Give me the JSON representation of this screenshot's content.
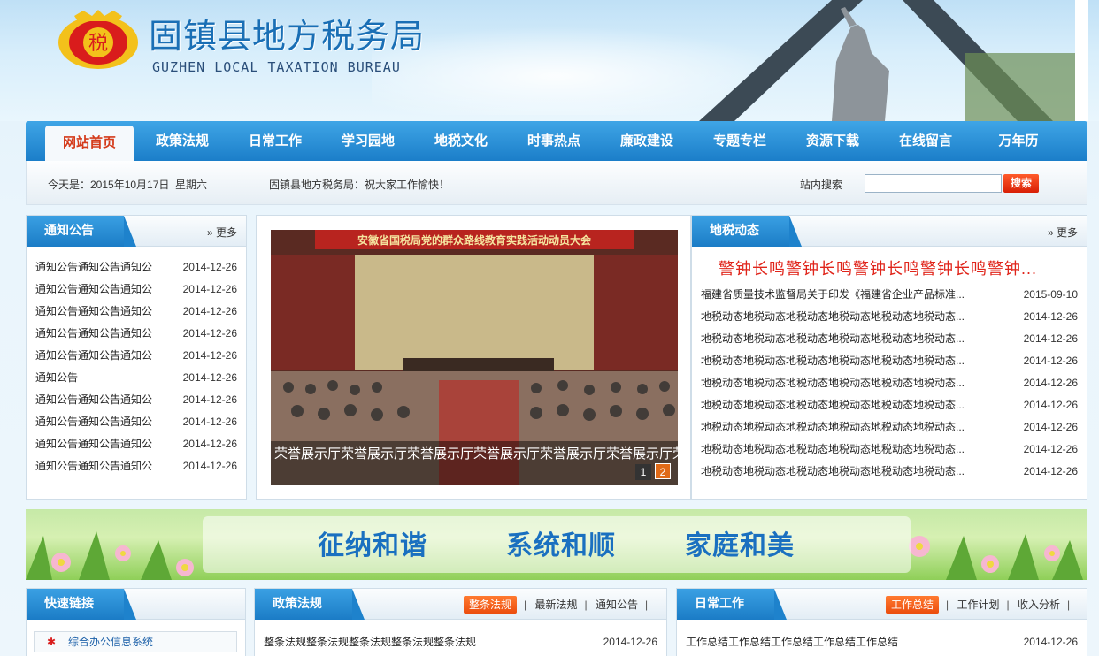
{
  "header": {
    "title": "固镇县地方税务局",
    "subtitle": "GUZHEN LOCAL TAXATION BUREAU",
    "emblem_glyph": "税"
  },
  "nav": {
    "items": [
      "网站首页",
      "政策法规",
      "日常工作",
      "学习园地",
      "地税文化",
      "时事热点",
      "廉政建设",
      "专题专栏",
      "资源下载",
      "在线留言",
      "万年历"
    ]
  },
  "infobar": {
    "date": "今天是：2015年10月17日",
    "weekday": "星期六",
    "greeting": "固镇县地方税务局：祝大家工作愉快！",
    "search_label": "站内搜索",
    "search_value": "",
    "search_button": "搜索"
  },
  "notice": {
    "title": "通知公告",
    "more": "更多",
    "items": [
      {
        "title": "通知公告通知公告通知公",
        "date": "2014-12-26"
      },
      {
        "title": "通知公告通知公告通知公",
        "date": "2014-12-26"
      },
      {
        "title": "通知公告通知公告通知公",
        "date": "2014-12-26"
      },
      {
        "title": "通知公告通知公告通知公",
        "date": "2014-12-26"
      },
      {
        "title": "通知公告通知公告通知公",
        "date": "2014-12-26"
      },
      {
        "title": "通知公告",
        "date": "2014-12-26"
      },
      {
        "title": "通知公告通知公告通知公",
        "date": "2014-12-26"
      },
      {
        "title": "通知公告通知公告通知公",
        "date": "2014-12-26"
      },
      {
        "title": "通知公告通知公告通知公",
        "date": "2014-12-26"
      },
      {
        "title": "通知公告通知公告通知公",
        "date": "2014-12-26"
      }
    ]
  },
  "slider": {
    "banner_text": "安徽省国税局党的群众路线教育实践活动动员大会",
    "caption": "荣誉展示厅荣誉展示厅荣誉展示厅荣誉展示厅荣誉展示厅荣誉展示厅荣誉展示厅荣",
    "pages": [
      "1",
      "2"
    ]
  },
  "news": {
    "title": "地税动态",
    "more": "更多",
    "headline": "警钟长鸣警钟长鸣警钟长鸣警钟长鸣警钟...",
    "items": [
      {
        "title": "福建省质量技术监督局关于印发《福建省企业产品标准...",
        "date": "2015-09-10"
      },
      {
        "title": "地税动态地税动态地税动态地税动态地税动态地税动态...",
        "date": "2014-12-26"
      },
      {
        "title": "地税动态地税动态地税动态地税动态地税动态地税动态...",
        "date": "2014-12-26"
      },
      {
        "title": "地税动态地税动态地税动态地税动态地税动态地税动态...",
        "date": "2014-12-26"
      },
      {
        "title": "地税动态地税动态地税动态地税动态地税动态地税动态...",
        "date": "2014-12-26"
      },
      {
        "title": "地税动态地税动态地税动态地税动态地税动态地税动态...",
        "date": "2014-12-26"
      },
      {
        "title": "地税动态地税动态地税动态地税动态地税动态地税动态...",
        "date": "2014-12-26"
      },
      {
        "title": "地税动态地税动态地税动态地税动态地税动态地税动态...",
        "date": "2014-12-26"
      },
      {
        "title": "地税动态地税动态地税动态地税动态地税动态地税动态...",
        "date": "2014-12-26"
      }
    ]
  },
  "banner": {
    "slogans": [
      "征纳和谐",
      "系统和顺",
      "家庭和美"
    ]
  },
  "quicklinks": {
    "title": "快速链接",
    "items": [
      "综合办公信息系统"
    ]
  },
  "policy": {
    "title": "政策法规",
    "tabs": [
      "整条法规",
      "最新法规",
      "通知公告"
    ],
    "items": [
      {
        "title": "整条法规整条法规整条法规整条法规整条法规",
        "date": "2014-12-26"
      }
    ]
  },
  "daily": {
    "title": "日常工作",
    "tabs": [
      "工作总结",
      "工作计划",
      "收入分析"
    ],
    "items": [
      {
        "title": "工作总结工作总结工作总结工作总结工作总结",
        "date": "2014-12-26"
      }
    ]
  },
  "colors": {
    "nav_blue": "#1b7ec9",
    "accent_red": "#e0251b",
    "tab_orange": "#ec4d0e"
  }
}
